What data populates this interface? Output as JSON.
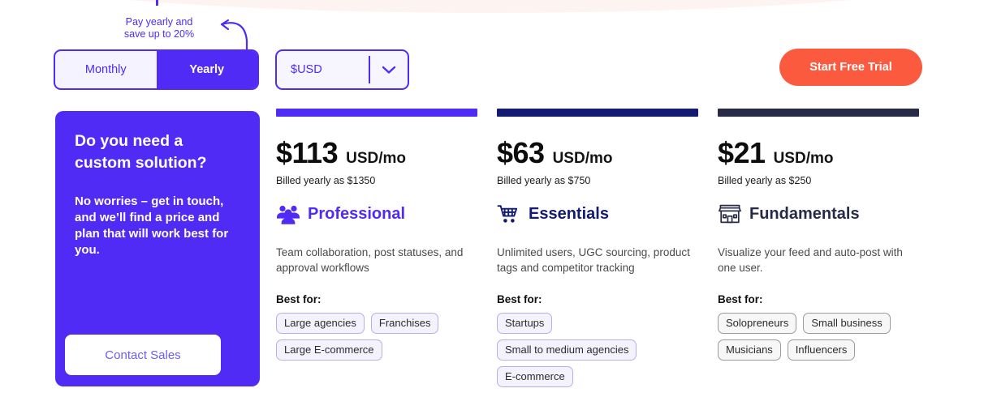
{
  "promo": {
    "note_line1": "Pay yearly and",
    "note_line2": "save up to 20%",
    "arrow_icon": "curved-arrow-left-icon"
  },
  "billing_toggle": {
    "options": [
      {
        "label": "Monthly",
        "active": false
      },
      {
        "label": "Yearly",
        "active": true
      }
    ]
  },
  "currency_select": {
    "value": "$USD",
    "chevron_icon": "chevron-down-icon"
  },
  "cta": {
    "label": "Start Free Trial",
    "color": "#FC5A3F"
  },
  "custom_card": {
    "title": "Do you need a custom solution?",
    "body": "No worries – get in touch, and we’ll find a price and plan that will work best for you.",
    "button_label": "Contact Sales",
    "bg_color": "#4F2BF5"
  },
  "plans": [
    {
      "accent_color": "#4F2BF5",
      "price": "$113",
      "price_unit": "USD/mo",
      "billed": "Billed yearly as $1350",
      "icon": "people-group-icon",
      "name": "Professional",
      "name_color": "#4F2BF5",
      "description": "Team collaboration, post statuses, and approval workflows",
      "best_for_label": "Best for:",
      "tags": [
        "Large agencies",
        "Franchises",
        "Large E-commerce"
      ],
      "tag_style": "purple"
    },
    {
      "accent_color": "#131A72",
      "price": "$63",
      "price_unit": "USD/mo",
      "billed": "Billed yearly as $750",
      "icon": "shopping-cart-icon",
      "name": "Essentials",
      "name_color": "#131A72",
      "description": "Unlimited users, UGC sourcing, product tags and competitor tracking",
      "best_for_label": "Best for:",
      "tags": [
        "Startups",
        "Small to medium agencies",
        "E-commerce"
      ],
      "tag_style": "purple"
    },
    {
      "accent_color": "#272B47",
      "price": "$21",
      "price_unit": "USD/mo",
      "billed": "Billed yearly as $250",
      "icon": "storefront-icon",
      "name": "Fundamentals",
      "name_color": "#272B47",
      "description": "Visualize your feed and auto-post with one user.",
      "best_for_label": "Best for:",
      "tags": [
        "Solopreneurs",
        "Small business",
        "Musicians",
        "Influencers"
      ],
      "tag_style": "gray"
    }
  ]
}
